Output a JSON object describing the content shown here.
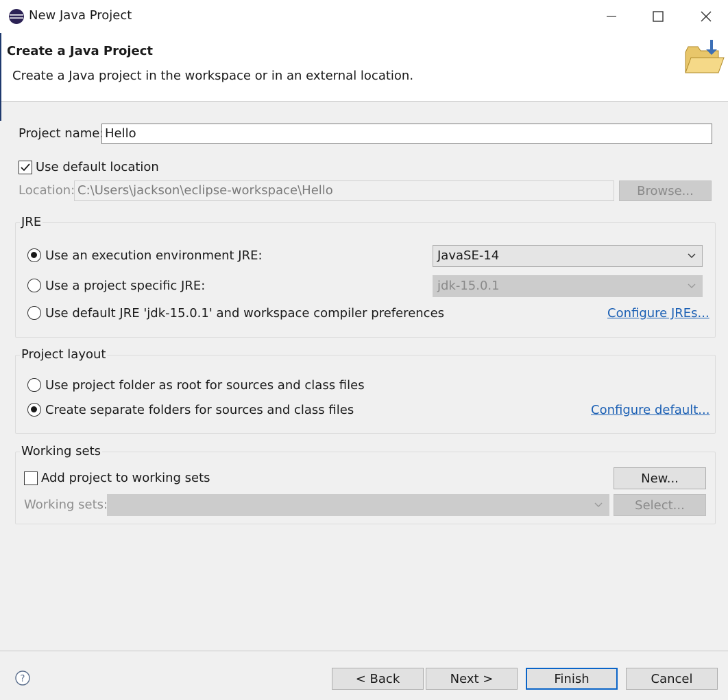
{
  "window": {
    "title": "New Java Project"
  },
  "banner": {
    "heading": "Create a Java Project",
    "description": "Create a Java project in the workspace or in an external location."
  },
  "project": {
    "name_label": "Project name:",
    "name_value": "Hello",
    "use_default_location_label": "Use default location",
    "use_default_location_checked": true,
    "location_label": "Location:",
    "location_value": "C:\\Users\\jackson\\eclipse-workspace\\Hello",
    "browse_label": "Browse..."
  },
  "jre": {
    "group_title": "JRE",
    "option_exec_env": "Use an execution environment JRE:",
    "exec_env_value": "JavaSE-14",
    "option_project_specific": "Use a project specific JRE:",
    "project_specific_value": "jdk-15.0.1",
    "option_default": "Use default JRE 'jdk-15.0.1' and workspace compiler preferences",
    "configure_link": "Configure JREs...",
    "selected": "exec_env"
  },
  "layout": {
    "group_title": "Project layout",
    "option_root": "Use project folder as root for sources and class files",
    "option_separate": "Create separate folders for sources and class files",
    "configure_link": "Configure default...",
    "selected": "separate"
  },
  "working_sets": {
    "group_title": "Working sets",
    "add_label": "Add project to working sets",
    "add_checked": false,
    "new_label": "New...",
    "sets_label": "Working sets:",
    "select_label": "Select..."
  },
  "footer": {
    "back_label": "< Back",
    "next_label": "Next >",
    "finish_label": "Finish",
    "cancel_label": "Cancel"
  },
  "colors": {
    "link": "#1a5fb4",
    "default_button_border": "#0a64c8",
    "dialog_bg": "#f0f0f0"
  },
  "icons": {
    "app": "eclipse-icon",
    "wizard": "new-folder-icon",
    "help": "help-icon"
  }
}
